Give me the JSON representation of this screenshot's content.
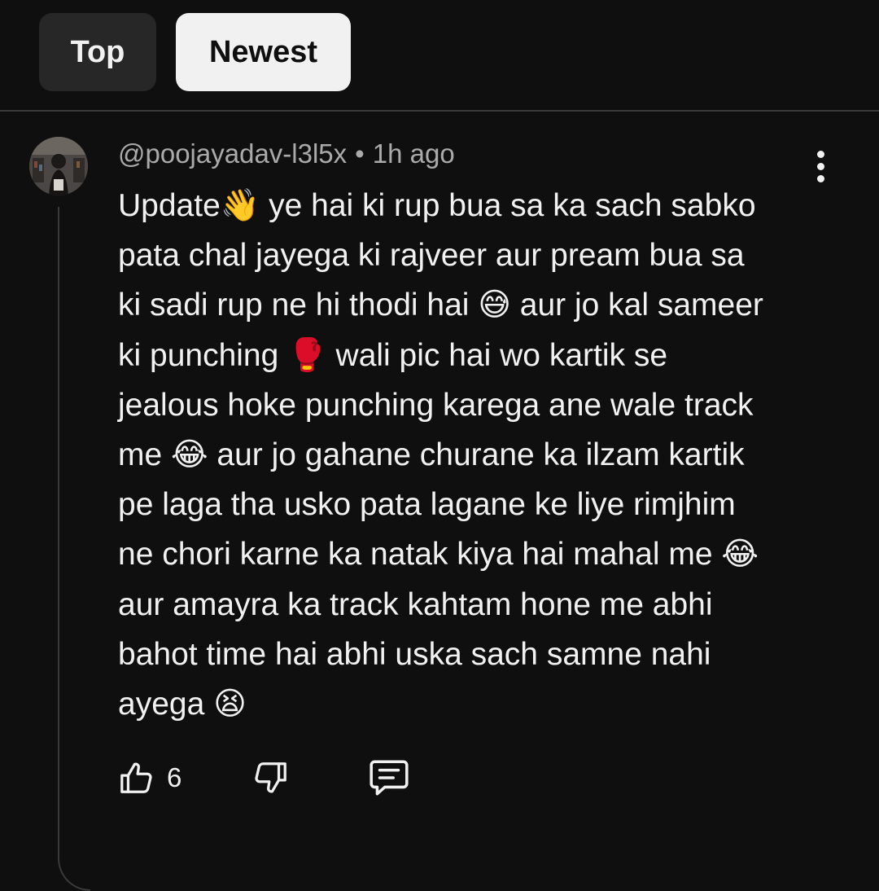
{
  "sort_tabs": {
    "top_label": "Top",
    "newest_label": "Newest",
    "active": "Newest"
  },
  "comment": {
    "author": "@poojayadav-l3l5x",
    "separator": "•",
    "timestamp": "1h ago",
    "lines": [
      "Update👋 ye hai ki rup bua sa ka sach sabko",
      "pata chal jayega ki rajveer aur pream bua sa",
      "ki sadi rup ne hi thodi hai 😅 aur jo kal sameer",
      "ki punching 🥊 wali pic hai wo kartik se",
      "jealous hoke punching karega ane wale track",
      "me  😂 aur jo gahane churane ka ilzam kartik",
      "pe laga tha usko pata lagane ke liye rimjhim",
      "ne chori karne ka natak kiya hai mahal me 😂",
      "aur amayra ka track kahtam hone me abhi",
      "bahot time hai abhi uska sach samne nahi",
      "ayega 😫"
    ],
    "like_count": "6"
  },
  "icons": {
    "like": "thumb-up-icon",
    "dislike": "thumb-down-icon",
    "reply": "comment-icon",
    "more": "more-vert-icon"
  },
  "colors": {
    "background": "#0f0f0f",
    "chip_inactive": "#272727",
    "chip_active": "#f1f1f1",
    "meta_text": "#aaaaaa",
    "divider": "#3a3a3a"
  }
}
